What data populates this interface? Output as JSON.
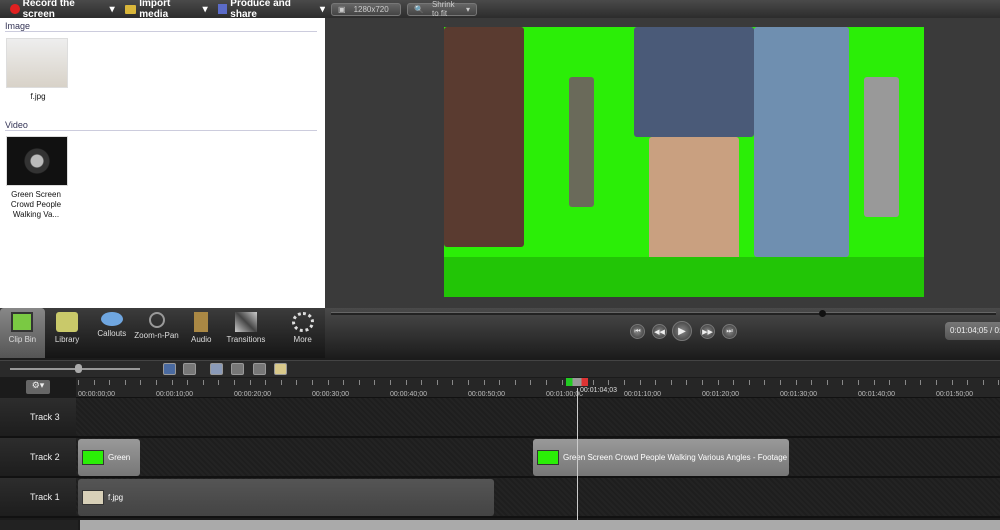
{
  "toolbar": {
    "record": "Record the screen",
    "import": "Import media",
    "produce": "Produce and share"
  },
  "bin": {
    "image_section": "Image",
    "image_name": "f.jpg",
    "video_section": "Video",
    "video_name": "Green Screen Crowd People Walking Va..."
  },
  "preview": {
    "dimensions": "1280x720",
    "zoom": "Shrink to fit",
    "timecode": "0:01:04;05 / 0:0"
  },
  "tools": [
    {
      "label": "Clip Bin"
    },
    {
      "label": "Library"
    },
    {
      "label": "Callouts"
    },
    {
      "label": "Zoom-n-Pan"
    },
    {
      "label": "Audio"
    },
    {
      "label": "Transitions"
    },
    {
      "label": "More"
    }
  ],
  "timeline": {
    "ticks": [
      "00:00:00;00",
      "00:00:10;00",
      "00:00:20;00",
      "00:00:30;00",
      "00:00:40;00",
      "00:00:50;00",
      "00:01:00;00",
      "00:01:10;00",
      "00:01:20;00",
      "00:01:30;00",
      "00:01:40;00",
      "00:01:50;00"
    ],
    "playhead": "00:01:04;03",
    "tracks": [
      {
        "label": "Track 3",
        "clips": []
      },
      {
        "label": "Track 2",
        "clips": [
          {
            "name": "Green"
          },
          {
            "name": "Green Screen Crowd People Walking Various Angles - Footage"
          }
        ]
      },
      {
        "label": "Track 1",
        "clips": [
          {
            "name": "f.jpg"
          }
        ]
      }
    ]
  },
  "colors": {
    "green_screen": "#2bee07",
    "record": "#e02020"
  }
}
